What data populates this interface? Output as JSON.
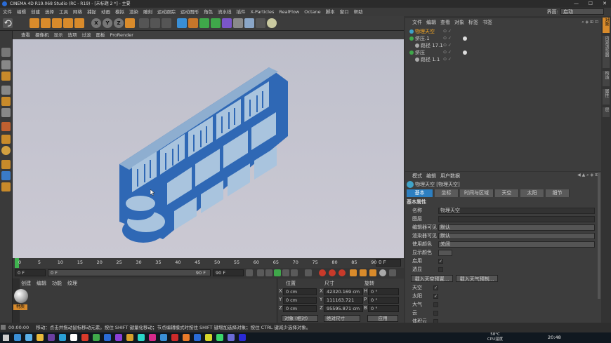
{
  "window": {
    "title": "CINEMA 4D R19.068 Studio (RC - R19) - [未标题 2 *] - 主要",
    "interface_label": "界面:",
    "interface_value": "启动"
  },
  "menu": [
    "文件",
    "编辑",
    "创建",
    "选择",
    "工具",
    "网格",
    "捕捉",
    "动画",
    "模拟",
    "渲染",
    "雕刻",
    "运动跟踪",
    "运动图形",
    "角色",
    "流水线",
    "插件",
    "X-Particles",
    "RealFlow",
    "Octane",
    "脚本",
    "窗口",
    "帮助"
  ],
  "toolbar_icons": [
    "undo-icon",
    "select-icon",
    "move-icon",
    "scale-icon",
    "rotate-icon",
    "last-tool-icon",
    "x-axis-icon",
    "y-axis-icon",
    "z-axis-icon",
    "coord-system-icon",
    "render-region-icon",
    "render-view-icon",
    "render-settings-icon",
    "cube-icon",
    "pen-icon",
    "subdivision-icon",
    "array-icon",
    "deformer-icon",
    "field-icon",
    "floor-icon",
    "camera-icon",
    "light-icon"
  ],
  "viewport": {
    "menu": [
      "查看",
      "摄像机",
      "显示",
      "选项",
      "过滤",
      "面板",
      "ProRender"
    ]
  },
  "timeline": {
    "ticks": [
      "0",
      "5",
      "10",
      "15",
      "20",
      "25",
      "30",
      "35",
      "40",
      "45",
      "50",
      "55",
      "60",
      "65",
      "70",
      "75",
      "80",
      "85",
      "90"
    ],
    "current_frame": "0 F",
    "start_frame": "0 F",
    "range_start": "0 F",
    "range_end": "90 F",
    "end_frame": "90 F"
  },
  "material_panel": {
    "menu": [
      "创建",
      "编辑",
      "功能",
      "纹理"
    ],
    "material_name": "材质"
  },
  "coord_panel": {
    "headers": [
      "位置",
      "尺寸",
      "旋转"
    ],
    "rows": [
      {
        "axis": "X",
        "pos": "0 cm",
        "size_axis": "X",
        "size": "42320.169 cm",
        "rot_axis": "H",
        "rot": "0 °"
      },
      {
        "axis": "Y",
        "pos": "0 cm",
        "size_axis": "Y",
        "size": "111163.721 cm",
        "rot_axis": "P",
        "rot": "0 °"
      },
      {
        "axis": "Z",
        "pos": "0 cm",
        "size_axis": "Z",
        "size": "95595.871 cm",
        "rot_axis": "B",
        "rot": "0 °"
      }
    ],
    "mode": "对象 (相对)",
    "size_mode": "绝对尺寸",
    "apply": "应用"
  },
  "object_manager": {
    "menu": [
      "文件",
      "编辑",
      "查看",
      "对象",
      "标签",
      "书签"
    ],
    "items": [
      {
        "name": "物理天空",
        "indent": 0,
        "selected": true
      },
      {
        "name": "挤压.1",
        "indent": 0,
        "selected": false
      },
      {
        "name": "路径 17.1",
        "indent": 1,
        "selected": false
      },
      {
        "name": "挤压",
        "indent": 0,
        "selected": false
      },
      {
        "name": "路径 1.1",
        "indent": 1,
        "selected": false
      }
    ]
  },
  "attribute_manager": {
    "menu": [
      "模式",
      "编辑",
      "用户数据"
    ],
    "object_title": "物理天空 [物理天空]",
    "tabs": [
      "基本",
      "坐标",
      "时间与区域",
      "天空",
      "太阳",
      "细节"
    ],
    "section": "基本属性",
    "fields": [
      {
        "label": "名称",
        "value": "物理天空"
      },
      {
        "label": "图层",
        "value": ""
      },
      {
        "label": "编辑器可见",
        "value": "默认"
      },
      {
        "label": "渲染器可见",
        "value": "默认"
      },
      {
        "label": "使用颜色",
        "value": "关闭"
      },
      {
        "label": "显示颜色",
        "value": ""
      }
    ],
    "checks": [
      {
        "label": "启用",
        "checked": true
      },
      {
        "label": "透显",
        "checked": false
      }
    ],
    "buttons": [
      "载入天空预置...",
      "载入天气预制..."
    ],
    "checks2": [
      {
        "label": "天空",
        "checked": true
      },
      {
        "label": "太阳",
        "checked": true
      },
      {
        "label": "大气",
        "checked": false
      },
      {
        "label": "云",
        "checked": false
      },
      {
        "label": "体积云",
        "checked": false
      }
    ]
  },
  "right_strip": [
    "对象",
    "内容浏览器",
    "构造",
    "属性",
    "层"
  ],
  "status": {
    "time": "00:00:00",
    "text": "移动：点击并拖动鼠标移动元素。按住 SHIFT 键量化移动；节点编辑模式时按住 SHIFT 键增加选择对象；按住 CTRL 键减少选择对象。"
  },
  "taskbar": {
    "cpu_value": "58°C",
    "cpu_label": "CPU温度",
    "clock": "20:48"
  },
  "colors": {
    "accent": "#f5a623",
    "selected_tab": "#2d7fc1",
    "viewport_bg": "#c4c3ce",
    "text_blue": "#2f68b5",
    "text_face": "#a9c4de"
  }
}
